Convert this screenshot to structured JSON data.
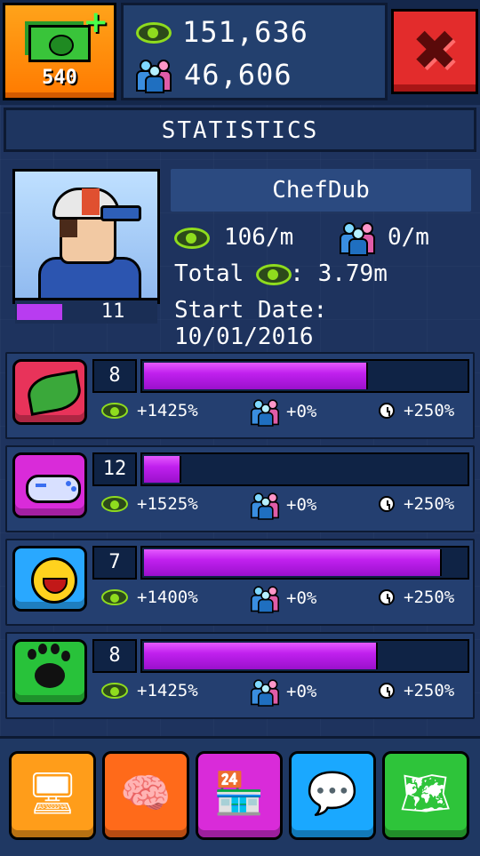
{
  "topbar": {
    "cash_amount": "540",
    "views_total": "151,636",
    "subscribers_total": "46,606",
    "icons": {
      "cash": "cash-plus-icon",
      "views": "eye-icon",
      "subscribers": "people-icon",
      "close": "close-icon"
    }
  },
  "header": {
    "title": "STATISTICS"
  },
  "profile": {
    "name": "ChefDub",
    "level": "11",
    "level_progress": 0.33,
    "views_rate": "106/m",
    "subs_rate": "0/m",
    "total_label": "Total",
    "total_value": ": 3.79m",
    "start_date_label": "Start Date:",
    "start_date": "10/01/2016"
  },
  "categories": [
    {
      "icon": "leaf-icon",
      "color": "#e8335a",
      "level": "8",
      "progress": 0.69,
      "views_bonus": "+1425%",
      "subs_bonus": "+0%",
      "time_bonus": "+250%"
    },
    {
      "icon": "gamepad-icon",
      "color": "#d92bd9",
      "level": "12",
      "progress": 0.11,
      "views_bonus": "+1525%",
      "subs_bonus": "+0%",
      "time_bonus": "+250%"
    },
    {
      "icon": "laughing-face-icon",
      "color": "#29a8ff",
      "level": "7",
      "progress": 0.92,
      "views_bonus": "+1400%",
      "subs_bonus": "+0%",
      "time_bonus": "+250%"
    },
    {
      "icon": "paw-icon",
      "color": "#28c23a",
      "level": "8",
      "progress": 0.72,
      "views_bonus": "+1425%",
      "subs_bonus": "+0%",
      "time_bonus": "+250%"
    }
  ],
  "bottom_tools": [
    {
      "icon": "computer-setup-icon",
      "color": "#ff9d1a"
    },
    {
      "icon": "brain-upgrade-icon",
      "color": "#ff6a1a"
    },
    {
      "icon": "shop-icon",
      "color": "#d92bd9"
    },
    {
      "icon": "chat-people-icon",
      "color": "#1aa8ff"
    },
    {
      "icon": "treasure-map-icon",
      "color": "#2ec43a"
    }
  ]
}
